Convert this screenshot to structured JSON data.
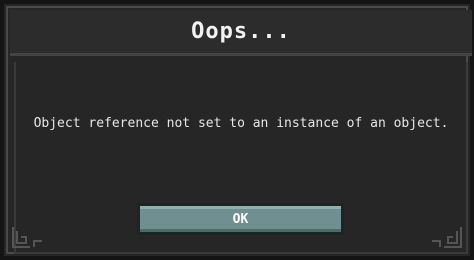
{
  "dialog": {
    "title": "Oops...",
    "message": "Object reference not set to an instance of an object.",
    "ok_label": "OK"
  },
  "colors": {
    "background": "#262626",
    "button": "#6f8f90",
    "text": "#e6e6e6"
  },
  "icons": {
    "corner_left": "corner-ornament-icon",
    "corner_right": "corner-ornament-icon"
  }
}
